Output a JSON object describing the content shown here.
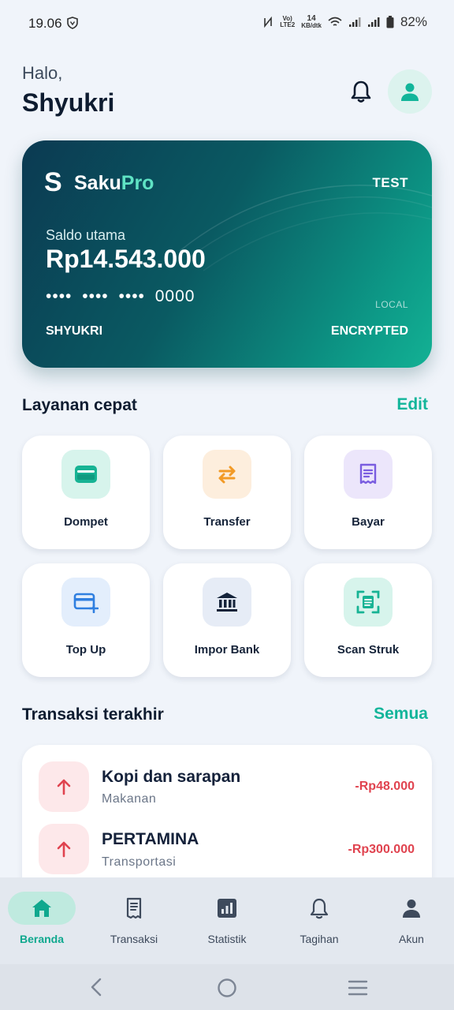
{
  "status_bar": {
    "time": "19.06",
    "net_top": "Vo)",
    "net_bottom": "LTE2",
    "speed_value": "14",
    "speed_unit": "KB/dtk",
    "battery": "82%"
  },
  "header": {
    "greeting": "Halo,",
    "name": "Shyukri"
  },
  "card": {
    "logo_letter": "S",
    "brand_part1": "Saku",
    "brand_part2": "Pro",
    "badge": "TEST",
    "balance_label": "Saldo utama",
    "balance": "Rp14.543.000",
    "masked_number": "•••• •••• •••• 0000",
    "local_label": "LOCAL",
    "holder": "SHYUKRI",
    "encryption": "ENCRYPTED",
    "accent_color": "#5fe3c4"
  },
  "quick_services": {
    "title": "Layanan cepat",
    "edit_label": "Edit",
    "items": [
      {
        "label": "Dompet",
        "icon": "wallet-icon"
      },
      {
        "label": "Transfer",
        "icon": "transfer-icon"
      },
      {
        "label": "Bayar",
        "icon": "receipt-icon"
      },
      {
        "label": "Top Up",
        "icon": "card-add-icon"
      },
      {
        "label": "Impor Bank",
        "icon": "bank-icon"
      },
      {
        "label": "Scan Struk",
        "icon": "scan-receipt-icon"
      }
    ]
  },
  "transactions": {
    "title": "Transaksi terakhir",
    "all_label": "Semua",
    "items": [
      {
        "name": "Kopi dan sarapan",
        "category": "Makanan",
        "amount": "-Rp48.000"
      },
      {
        "name": "PERTAMINA",
        "category": "Transportasi",
        "amount": "-Rp300.000"
      }
    ]
  },
  "bottom_nav": {
    "items": [
      {
        "label": "Beranda",
        "icon": "home-icon",
        "active": true
      },
      {
        "label": "Transaksi",
        "icon": "receipt-list-icon",
        "active": false
      },
      {
        "label": "Statistik",
        "icon": "chart-icon",
        "active": false
      },
      {
        "label": "Tagihan",
        "icon": "bell-icon",
        "active": false
      },
      {
        "label": "Akun",
        "icon": "person-icon",
        "active": false
      }
    ]
  },
  "colors": {
    "brand_teal": "#12b59a",
    "negative_amount": "#e0434f",
    "background": "#f0f4fa"
  }
}
